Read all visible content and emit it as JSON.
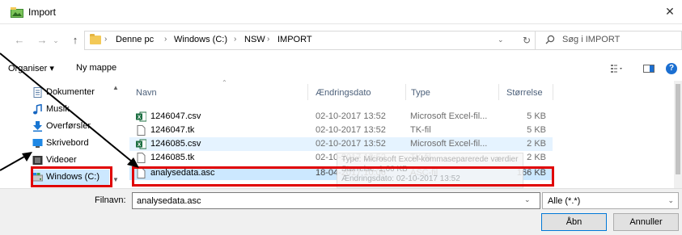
{
  "window": {
    "title": "Import"
  },
  "address": {
    "crumbs": [
      "Denne pc",
      "Windows (C:)",
      "NSW",
      "IMPORT"
    ],
    "search_placeholder": "Søg i IMPORT"
  },
  "toolbar": {
    "organize": "Organiser ▾",
    "new_folder": "Ny mappe"
  },
  "nav": {
    "items": [
      {
        "label": "Dokumenter",
        "icon": "documents-icon"
      },
      {
        "label": "Musik",
        "icon": "music-icon"
      },
      {
        "label": "Overførsler",
        "icon": "downloads-icon"
      },
      {
        "label": "Skrivebord",
        "icon": "desktop-icon"
      },
      {
        "label": "Videoer",
        "icon": "videos-icon"
      },
      {
        "label": "Windows (C:)",
        "icon": "drive-icon"
      }
    ]
  },
  "columns": {
    "name": "Navn",
    "date": "Ændringsdato",
    "type": "Type",
    "size": "Størrelse"
  },
  "files": [
    {
      "name": "1246047.csv",
      "date": "02-10-2017 13:52",
      "type": "Microsoft Excel-fil...",
      "size": "5 KB",
      "icon": "excel-file-icon"
    },
    {
      "name": "1246047.tk",
      "date": "02-10-2017 13:52",
      "type": "TK-fil",
      "size": "5 KB",
      "icon": "generic-file-icon"
    },
    {
      "name": "1246085.csv",
      "date": "02-10-2017 13:52",
      "type": "Microsoft Excel-fil...",
      "size": "2 KB",
      "icon": "excel-file-icon"
    },
    {
      "name": "1246085.tk",
      "date": "02-10-2017 13:52",
      "type": "TK-fil",
      "size": "2 KB",
      "icon": "generic-file-icon"
    },
    {
      "name": "analysedata.asc",
      "date": "18-04-2017 10:06",
      "type": "ASC-fil",
      "size": "166 KB",
      "icon": "generic-file-icon"
    }
  ],
  "tooltip": {
    "line1": "Type: Microsoft Excel-kommaseparerede værdier",
    "line2": "Størrelse: 1,66 KB",
    "line3": "Ændringsdato: 02-10-2017 13:52"
  },
  "bottom": {
    "filename_label": "Filnavn:",
    "filename_value": "analysedata.asc",
    "filetype": "Alle (*.*)",
    "open": "Åbn",
    "cancel": "Annuller"
  },
  "colors": {
    "annotation": "#e00000",
    "selection": "#cce8ff",
    "hover": "#e5f3ff"
  }
}
